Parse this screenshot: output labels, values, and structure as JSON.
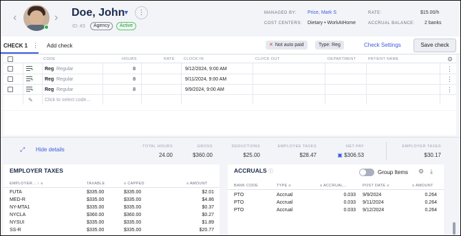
{
  "employee": {
    "name": "Doe, John",
    "id_label": "ID: #3",
    "badges": [
      "Agency",
      "Active"
    ]
  },
  "meta": {
    "managed_by_label": "MANAGED BY:",
    "managed_by_value": "Price, Mark S",
    "cost_centers_label": "COST CENTERS:",
    "cost_centers_value": "Dietary • WorkAtHome",
    "rate_label": "RATE:",
    "rate_value": "$15.00/h",
    "accrual_label": "ACCRUAL BALANCE:",
    "accrual_value": "2 banks"
  },
  "tabs": {
    "check": "CHECK 1",
    "add": "Add check",
    "chip_not_auto_paid": "Not auto paid",
    "chip_type": "Type: Reg",
    "check_settings": "Check Settings",
    "save_check": "Save check"
  },
  "grid": {
    "headers": [
      "CODE",
      "HOURS",
      "RATE",
      "CLOCK IN",
      "CLOCK OUT",
      "DEPARTMENT",
      "PATIENT NAME"
    ],
    "rows": [
      {
        "code": "Reg",
        "code_desc": "Regular",
        "hours": "8",
        "clock_in": "9/12/2024, 9:00 AM"
      },
      {
        "code": "Reg",
        "code_desc": "Regular",
        "hours": "8",
        "clock_in": "9/11/2024, 9:00 AM"
      },
      {
        "code": "Reg",
        "code_desc": "Regular",
        "hours": "8",
        "clock_in": "9/9/2024, 9:00 AM"
      }
    ],
    "new_row_placeholder": "Click to select code..."
  },
  "summary": {
    "hide_details": "Hide details",
    "items": [
      {
        "label": "TOTAL HOURS",
        "value": "24.00"
      },
      {
        "label": "GROSS",
        "value": "$360.00"
      },
      {
        "label": "DEDUCTIONS",
        "value": "$25.00"
      },
      {
        "label": "EMPLOYEE TAXES",
        "value": "$28.47"
      },
      {
        "label": "NET PAY",
        "value": "$306.53"
      },
      {
        "label": "EMPLOYER TAXES",
        "value": "$30.17"
      }
    ]
  },
  "employer_taxes": {
    "title": "EMPLOYER TAXES",
    "headers": [
      "EMPLOYER...",
      "TAXABLE",
      "CAPPED",
      "AMOUNT"
    ],
    "rows": [
      {
        "name": "FUTA",
        "taxable": "$335.00",
        "capped": "$335.00",
        "amount": "$2.01"
      },
      {
        "name": "MED-R",
        "taxable": "$335.00",
        "capped": "$335.00",
        "amount": "$4.86"
      },
      {
        "name": "NY-MTA1",
        "taxable": "$335.00",
        "capped": "$335.00",
        "amount": "$0.37"
      },
      {
        "name": "NYCLA",
        "taxable": "$360.00",
        "capped": "$360.00",
        "amount": "$0.27"
      },
      {
        "name": "NYSUI",
        "taxable": "$335.00",
        "capped": "$335.00",
        "amount": "$1.89"
      },
      {
        "name": "SS-R",
        "taxable": "$335.00",
        "capped": "$335.00",
        "amount": "$20.77"
      }
    ]
  },
  "accruals": {
    "title": "ACCRUALS",
    "group_items": "Group Items",
    "headers": [
      "BANK CODE",
      "TYPE",
      "ACCRUAL...",
      "POST DATE",
      "AMOUNT"
    ],
    "rows": [
      {
        "bank": "PTO",
        "type": "Accrual",
        "accrual": "0.033",
        "post_date": "9/9/2024",
        "amount": "0.264"
      },
      {
        "bank": "PTO",
        "type": "Accrual",
        "accrual": "0.033",
        "post_date": "9/11/2024",
        "amount": "0.264"
      },
      {
        "bank": "PTO",
        "type": "Accrual",
        "accrual": "0.033",
        "post_date": "9/12/2024",
        "amount": "0.264"
      }
    ]
  },
  "colors": {
    "accent": "#3b5bdb",
    "active": "#2bb24c"
  }
}
